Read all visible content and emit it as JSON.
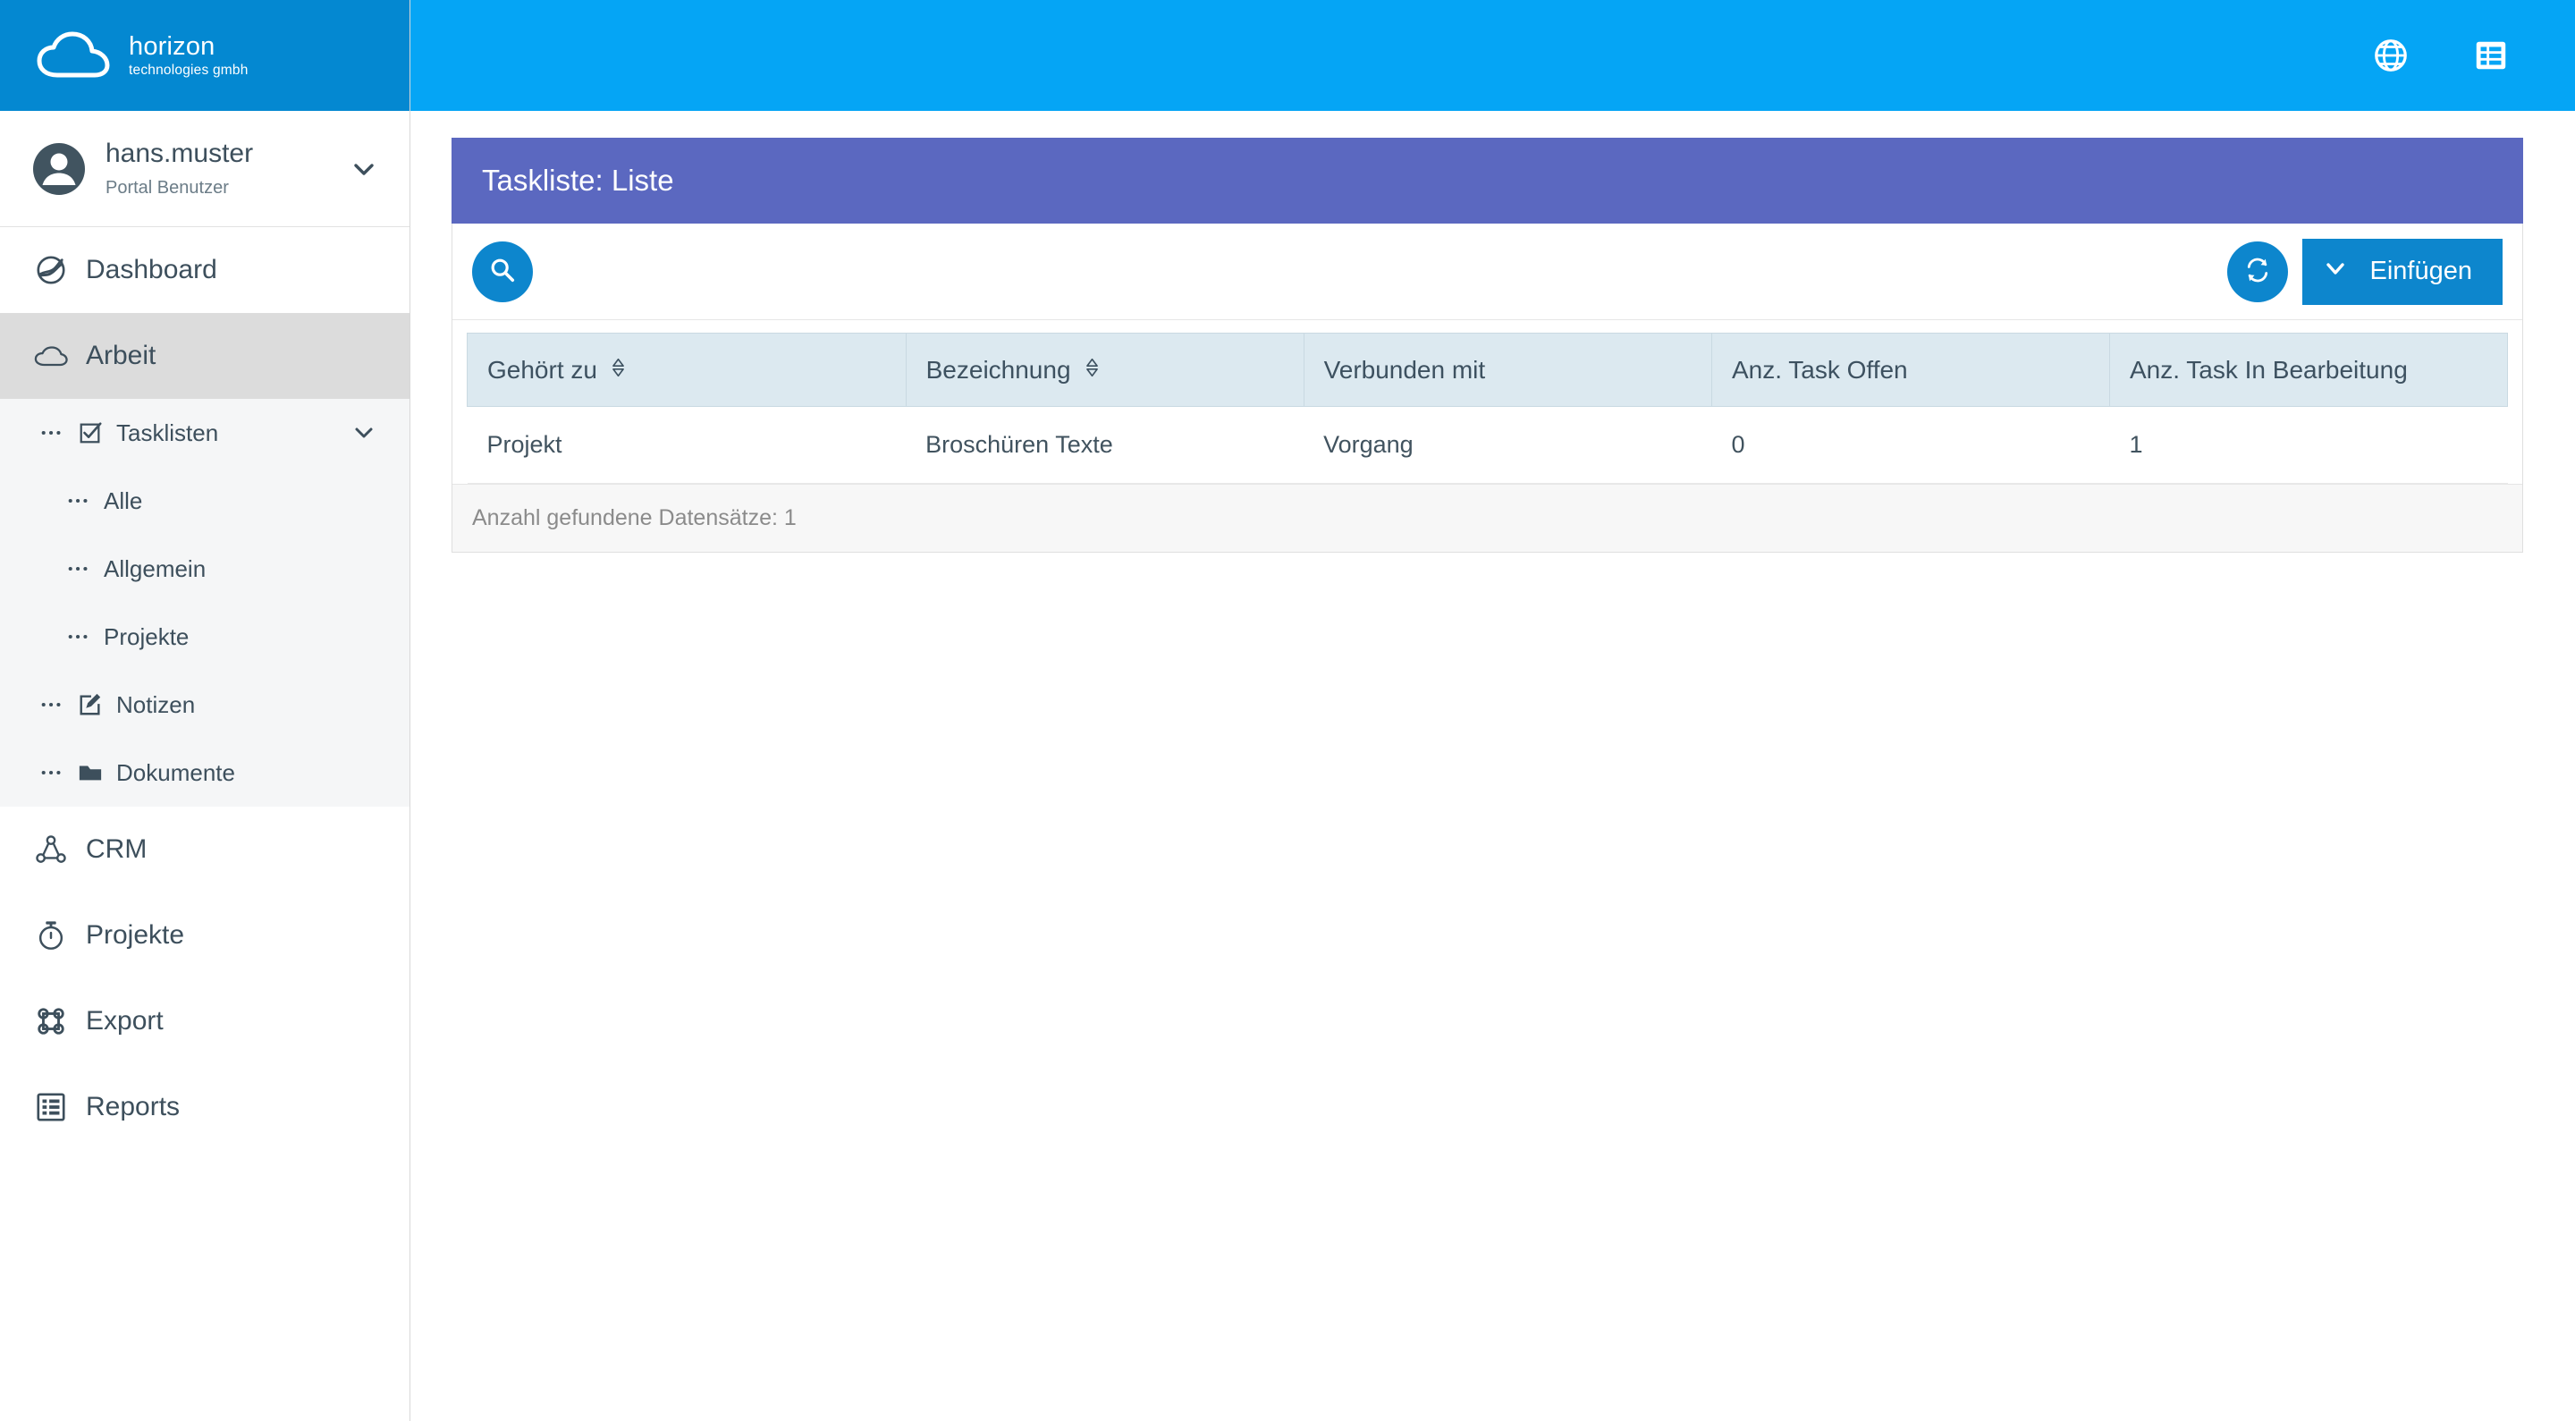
{
  "brand": {
    "name": "horizon",
    "tagline": "technologies gmbh",
    "logo_icon": "cloud-logo-icon"
  },
  "topbar": {
    "language_icon": "globe-icon",
    "list_icon": "list-view-icon"
  },
  "profile": {
    "avatar_icon": "user-avatar-icon",
    "username": "hans.muster",
    "role": "Portal Benutzer",
    "expand_icon": "chevron-down-icon"
  },
  "sidebar": {
    "items": [
      {
        "label": "Dashboard",
        "icon": "dashboard-globe-icon",
        "active": false
      },
      {
        "label": "Arbeit",
        "icon": "cloud-icon",
        "active": true
      },
      {
        "label": "CRM",
        "icon": "crm-network-icon",
        "active": false
      },
      {
        "label": "Projekte",
        "icon": "stopwatch-icon",
        "active": false
      },
      {
        "label": "Export",
        "icon": "command-export-icon",
        "active": false
      },
      {
        "label": "Reports",
        "icon": "report-grid-icon",
        "active": false
      }
    ],
    "subitems": [
      {
        "label": "Tasklisten",
        "icon": "checkbox-icon",
        "level": 1,
        "expandable": true,
        "expand_icon": "chevron-down-icon"
      },
      {
        "label": "Alle",
        "icon": "",
        "level": 2,
        "expandable": false
      },
      {
        "label": "Allgemein",
        "icon": "",
        "level": 2,
        "expandable": false
      },
      {
        "label": "Projekte",
        "icon": "",
        "level": 2,
        "expandable": false
      },
      {
        "label": "Notizen",
        "icon": "note-edit-icon",
        "level": 1,
        "expandable": false
      },
      {
        "label": "Dokumente",
        "icon": "folder-icon",
        "level": 1,
        "expandable": false
      }
    ],
    "dots_icon": "ellipsis-icon"
  },
  "panel": {
    "title": "Taskliste: Liste",
    "search_icon": "search-icon",
    "refresh_icon": "refresh-icon",
    "insert_label": "Einfügen",
    "insert_caret_icon": "chevron-down-icon",
    "footer": "Anzahl gefundene Datensätze: 1"
  },
  "table": {
    "columns": [
      {
        "label": "Gehört zu",
        "sortable": true,
        "sort_icon": "sort-icon"
      },
      {
        "label": "Bezeichnung",
        "sortable": true,
        "sort_icon": "sort-icon"
      },
      {
        "label": "Verbunden mit",
        "sortable": false
      },
      {
        "label": "Anz. Task Offen",
        "sortable": false
      },
      {
        "label": "Anz. Task In Bearbeitung",
        "sortable": false
      }
    ],
    "rows": [
      {
        "gehoert_zu": "Projekt",
        "bezeichnung": "Broschüren Texte",
        "verbunden_mit": "Vorgang",
        "anz_task_offen": "0",
        "anz_task_in_bearbeitung": "1"
      }
    ]
  },
  "colors": {
    "topbar_blue": "#05a5f5",
    "brand_blue": "#0488d1",
    "panel_purple": "#5b68c0",
    "accent_blue": "#0d86cd",
    "table_header": "#dce9f0",
    "sidebar_active": "#dcdcdc",
    "text_dark": "#3d4f5c"
  }
}
